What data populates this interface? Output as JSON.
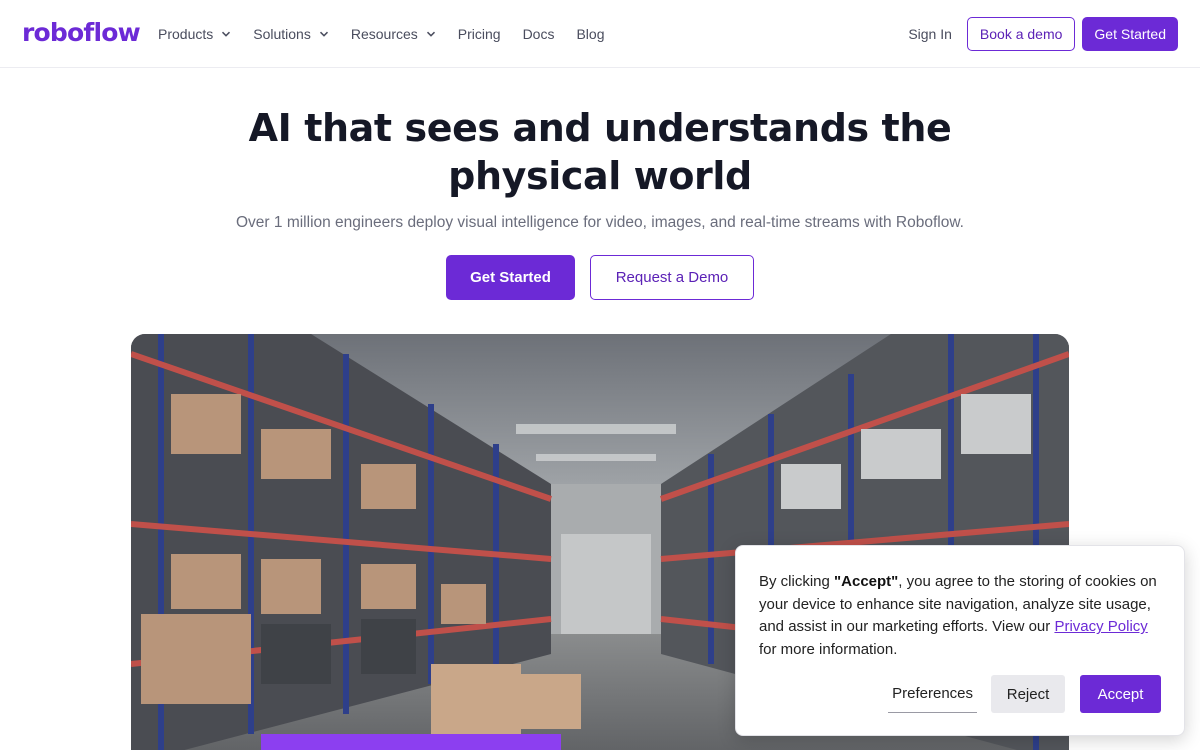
{
  "nav": {
    "logo": "roboflow",
    "links": [
      {
        "label": "Products",
        "dropdown": true
      },
      {
        "label": "Solutions",
        "dropdown": true
      },
      {
        "label": "Resources",
        "dropdown": true
      },
      {
        "label": "Pricing",
        "dropdown": false
      },
      {
        "label": "Docs",
        "dropdown": false
      },
      {
        "label": "Blog",
        "dropdown": false
      }
    ],
    "sign_in": "Sign In",
    "book_demo": "Book a demo",
    "get_started": "Get Started"
  },
  "hero": {
    "title_line1": "AI that sees and understands the",
    "title_line2": "physical world",
    "subtitle": "Over 1 million engineers deploy visual intelligence for video, images, and real-time streams with Roboflow.",
    "primary_cta": "Get Started",
    "secondary_cta": "Request a Demo"
  },
  "media": {
    "description_icon": "warehouse-video"
  },
  "cookie": {
    "text_before": "By clicking ",
    "text_bold": "\"Accept\"",
    "text_after": ", you agree to the storing of cookies on your device to enhance site navigation, analyze site usage, and assist in our marketing efforts. View our ",
    "link_text": "Privacy Policy",
    "text_end": " for more information.",
    "preferences": "Preferences",
    "reject": "Reject",
    "accept": "Accept"
  },
  "colors": {
    "brand": "#6c2ad6",
    "heading": "#151826",
    "muted": "#6a6d7c"
  }
}
